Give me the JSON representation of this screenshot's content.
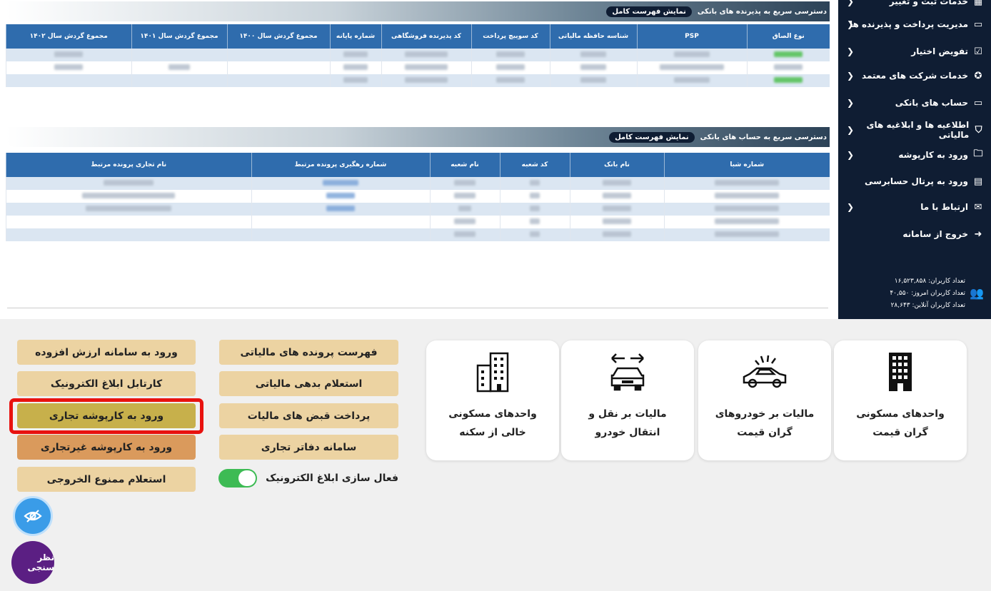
{
  "sidebar": {
    "items": [
      {
        "label": "خدمات ثبت و تغییر",
        "icon": "store-icon",
        "chevron": true
      },
      {
        "label": "مدیریت پرداخت و پذیرنده ها",
        "icon": "card-icon",
        "chevron": true
      },
      {
        "label": "تفویض اختیار",
        "icon": "delegation-icon",
        "chevron": true
      },
      {
        "label": "خدمات شرکت های معتمد",
        "icon": "badge-icon",
        "chevron": true
      },
      {
        "label": "حساب های بانکی",
        "icon": "card-icon",
        "chevron": true
      },
      {
        "label": "اطلاعیه ها و ابلاغیه های مالیاتی",
        "icon": "notice-icon",
        "chevron": true
      },
      {
        "label": "ورود به کارپوشه",
        "icon": "folder-icon",
        "chevron": true
      },
      {
        "label": "ورود به پرتال حسابرسی",
        "icon": "audit-icon",
        "chevron": false
      },
      {
        "label": "ارتباط با ما",
        "icon": "mail-icon",
        "chevron": true
      },
      {
        "label": "خروج از سامانه",
        "icon": "logout-icon",
        "chevron": false
      }
    ],
    "stats": {
      "total_users": "تعداد کاربران: ۱۶,۵۲۳,۸۵۸",
      "today_users": "تعداد کاربران امروز: ۴۰,۵۵۰",
      "online_users": "تعداد کاربران آنلاین: ۲۸,۶۴۳"
    }
  },
  "pos_panel": {
    "title": "دسترسی سریع به پذیرنده های بانکی",
    "full_list_button": "نمایش فهرست کامل",
    "columns": [
      "نوع الصاق",
      "PSP",
      "شناسه حافظه مالیاتی",
      "کد سوییچ پرداخت",
      "کد پذیرنده فروشگاهی",
      "شماره پایانه",
      "مجموع گردش سال ۱۴۰۰",
      "مجموع گردش سال ۱۴۰۱",
      "مجموع گردش سال ۱۴۰۲"
    ]
  },
  "bank_panel": {
    "title": "دسترسی سریع به حساب های بانکی",
    "full_list_button": "نمایش فهرست کامل",
    "columns": [
      "شماره شبا",
      "نام بانک",
      "کد شعبه",
      "نام شعبه",
      "شماره رهگیری پرونده مرتبط",
      "نام تجاری پرونده مرتبط"
    ]
  },
  "cards": [
    {
      "line1": "واحدهای مسکونی",
      "line2": "گران قیمت",
      "icon": "building-icon"
    },
    {
      "line1": "مالیات بر خودروهای",
      "line2": "گران قیمت",
      "icon": "car-icon"
    },
    {
      "line1": "مالیات بر نقل و",
      "line2": "انتقال خودرو",
      "icon": "car-transfer-icon"
    },
    {
      "line1": "واحدهای مسکونی",
      "line2": "خالی از سکنه",
      "icon": "buildings-icon"
    }
  ],
  "quick": {
    "tax_files": "فهرست پرونده های مالیاتی",
    "tax_debt": "استعلام بدهی مالیاتی",
    "tax_receipts": "پرداخت قبض های مالیات",
    "commercial_books": "سامانه دفاتر تجاری",
    "vat_login": "ورود به سامانه ارزش افزوده",
    "e_notice": "کارتابل ابلاغ الکترونیک",
    "commercial_folder": "ورود به کارپوشه تجاری",
    "noncommercial_folder": "ورود به کارپوشه غیرتجاری",
    "exit_ban": "استعلام ممنوع الخروجی",
    "e_notice_toggle": "فعال سازی ابلاغ الکترونیک"
  },
  "toggle": {
    "on": true
  },
  "survey_label": "نظر سنجی",
  "colors": {
    "sidebar": "#0f1d33",
    "table_header": "#2f6cad",
    "button": "#ecd3a2",
    "active_button": "#c7b04b",
    "highlight": "#e8120f",
    "toggle_on": "#3dbb54"
  }
}
